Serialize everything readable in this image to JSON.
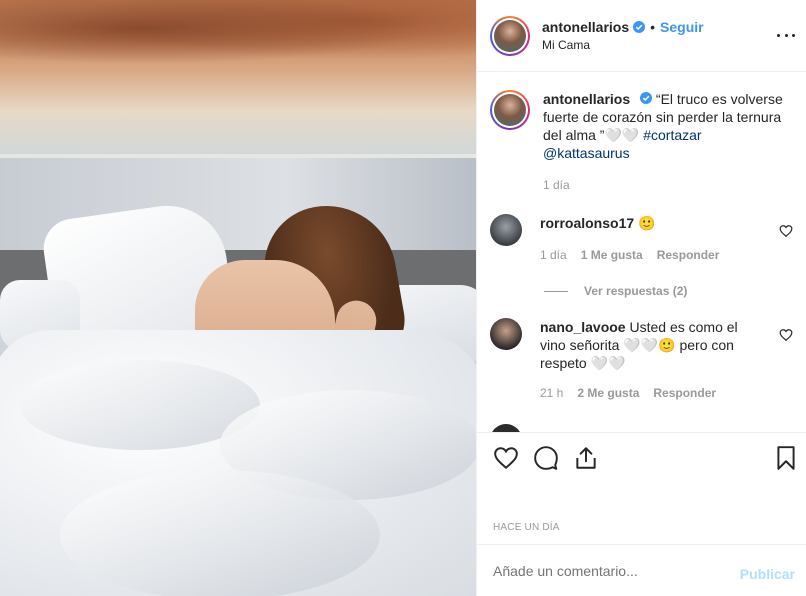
{
  "header": {
    "username": "antonellarios",
    "separator": "•",
    "follow_label": "Seguir",
    "location": "Mi Cama"
  },
  "caption": {
    "username": "antonellarios",
    "text": "“El truco es volverse fuerte de corazón sin perder la ternura del alma ”🤍🤍",
    "hashtag": "#cortazar",
    "mention": "@kattasaurus",
    "time": "1 día"
  },
  "comments": [
    {
      "username": "rorroalonso17",
      "text": "🙂",
      "time": "1 día",
      "likes": "1 Me gusta",
      "reply_label": "Responder"
    },
    {
      "username": "nano_lavooe",
      "text": "Usted es como el vino señorita 🤍🤍🙂 pero con respeto 🤍🤍",
      "time": "21 h",
      "likes": "2 Me gusta",
      "reply_label": "Responder"
    }
  ],
  "view_replies": "Ver respuestas (2)",
  "date": "HACE UN DÍA",
  "add_comment": {
    "placeholder": "Añade un comentario...",
    "publish_label": "Publicar"
  },
  "colors": {
    "accent": "#3897f0",
    "link": "#003569",
    "muted": "#999999",
    "publish_disabled": "#b2dffc"
  },
  "icons": [
    "verified-badge-icon",
    "more-options-icon",
    "heart-icon",
    "comment-icon",
    "share-icon",
    "bookmark-icon"
  ]
}
